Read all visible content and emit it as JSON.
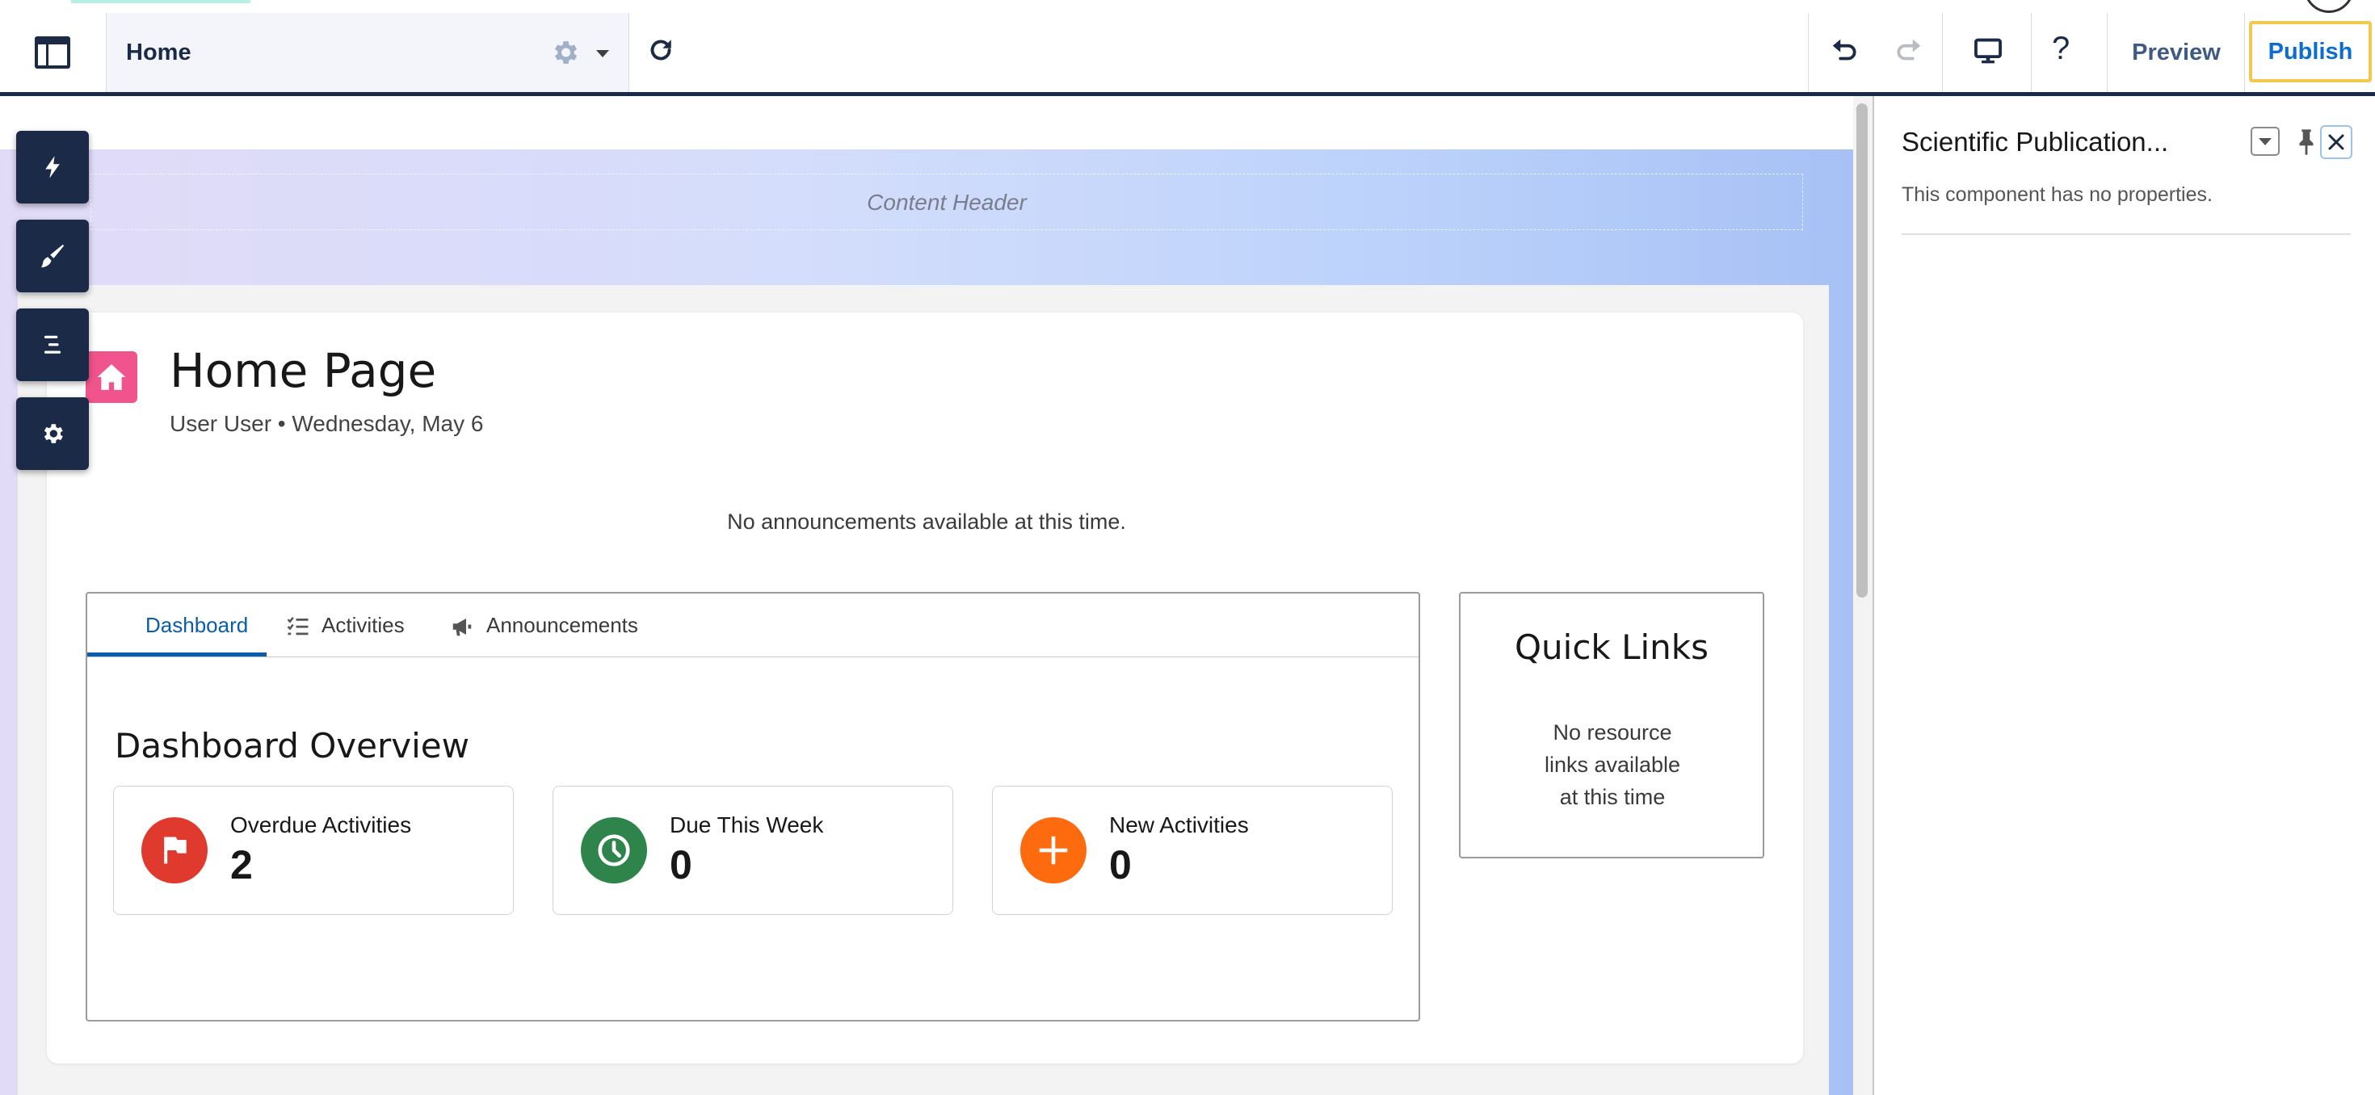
{
  "topbar": {
    "page_name": "Home",
    "preview_label": "Preview",
    "publish_label": "Publish",
    "help_label": "?"
  },
  "content": {
    "content_header": "Content Header",
    "home_title": "Home Page",
    "home_subtitle": "User User • Wednesday, May 6",
    "no_announcements": "No announcements available at this time."
  },
  "tabs": [
    {
      "label": "Dashboard",
      "active": true
    },
    {
      "label": "Activities",
      "active": false
    },
    {
      "label": "Announcements",
      "active": false
    }
  ],
  "dashboard": {
    "title": "Dashboard Overview",
    "stats": [
      {
        "label": "Overdue Activities",
        "value": "2",
        "color": "#e03a2f",
        "icon": "flag-icon"
      },
      {
        "label": "Due This Week",
        "value": "0",
        "color": "#2e844a",
        "icon": "clock-icon"
      },
      {
        "label": "New Activities",
        "value": "0",
        "color": "#fe6b0f",
        "icon": "plus-icon"
      }
    ]
  },
  "quick_links": {
    "title": "Quick Links",
    "line1": "No resource",
    "line2": "links available",
    "line3": "at this time"
  },
  "panel": {
    "title": "Scientific Publication...",
    "description": "This component has no properties."
  },
  "colors": {
    "navy": "#1b2a47",
    "accent": "#0b6cd1",
    "publish_border": "#f2c94c",
    "home_icon": "#f1548c"
  }
}
